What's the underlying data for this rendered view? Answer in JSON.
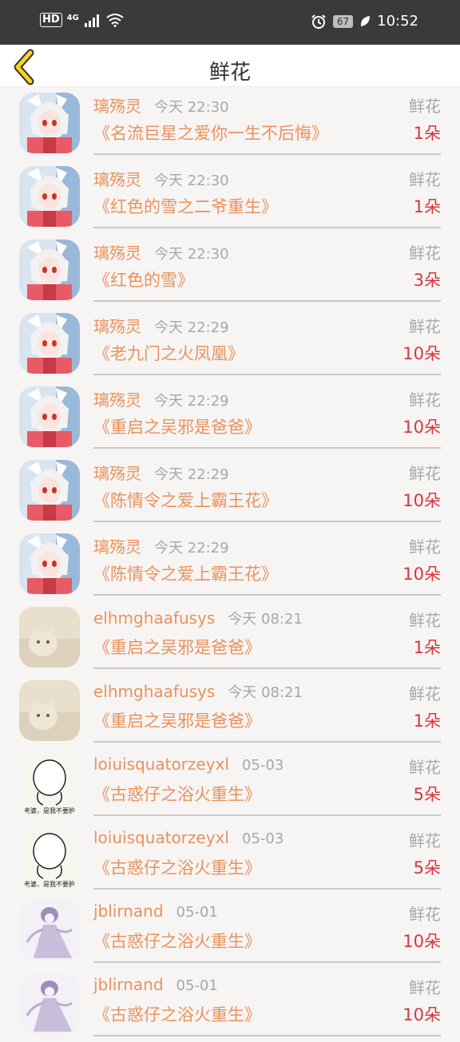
{
  "status_bar": {
    "hd": "HD",
    "network": "4G",
    "battery": "67",
    "time": "10:52"
  },
  "header": {
    "title": "鲜花"
  },
  "list": [
    {
      "user": "璃殇灵",
      "time": "今天 22:30",
      "label": "鲜花",
      "book": "《名流巨星之爱你一生不后悔》",
      "count": "1朵",
      "avatar": "anime"
    },
    {
      "user": "璃殇灵",
      "time": "今天 22:30",
      "label": "鲜花",
      "book": "《红色的雪之二爷重生》",
      "count": "1朵",
      "avatar": "anime"
    },
    {
      "user": "璃殇灵",
      "time": "今天 22:30",
      "label": "鲜花",
      "book": "《红色的雪》",
      "count": "3朵",
      "avatar": "anime"
    },
    {
      "user": "璃殇灵",
      "time": "今天 22:29",
      "label": "鲜花",
      "book": "《老九门之火凤凰》",
      "count": "10朵",
      "avatar": "anime"
    },
    {
      "user": "璃殇灵",
      "time": "今天 22:29",
      "label": "鲜花",
      "book": "《重启之吴邪是爸爸》",
      "count": "10朵",
      "avatar": "anime"
    },
    {
      "user": "璃殇灵",
      "time": "今天 22:29",
      "label": "鲜花",
      "book": "《陈情令之爱上霸王花》",
      "count": "10朵",
      "avatar": "anime"
    },
    {
      "user": "璃殇灵",
      "time": "今天 22:29",
      "label": "鲜花",
      "book": "《陈情令之爱上霸王花》",
      "count": "10朵",
      "avatar": "anime"
    },
    {
      "user": "elhmghaafusys",
      "time": "今天 08:21",
      "label": "鲜花",
      "book": "《重启之吴邪是爸爸》",
      "count": "1朵",
      "avatar": "cat"
    },
    {
      "user": "elhmghaafusys",
      "time": "今天 08:21",
      "label": "鲜花",
      "book": "《重启之吴邪是爸爸》",
      "count": "1朵",
      "avatar": "cat"
    },
    {
      "user": "loiuisquatorzeyxl",
      "time": "05-03",
      "label": "鲜花",
      "book": "《古惑仔之浴火重生》",
      "count": "5朵",
      "avatar": "sketch",
      "avatar_caption": "老婆，是我不要脸"
    },
    {
      "user": "loiuisquatorzeyxl",
      "time": "05-03",
      "label": "鲜花",
      "book": "《古惑仔之浴火重生》",
      "count": "5朵",
      "avatar": "sketch",
      "avatar_caption": "老婆，是我不要脸"
    },
    {
      "user": "jblirnand",
      "time": "05-01",
      "label": "鲜花",
      "book": "《古惑仔之浴火重生》",
      "count": "10朵",
      "avatar": "ghost"
    },
    {
      "user": "jblirnand",
      "time": "05-01",
      "label": "鲜花",
      "book": "《古惑仔之浴火重生》",
      "count": "10朵",
      "avatar": "ghost"
    }
  ]
}
